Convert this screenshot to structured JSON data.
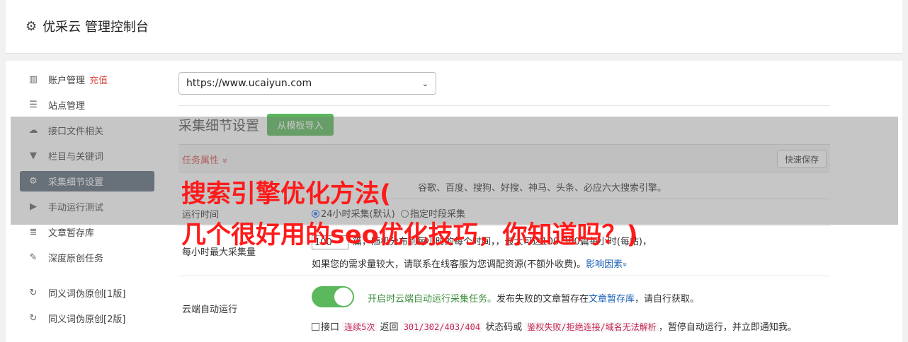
{
  "header": {
    "gear_icon": "gear-icon",
    "title": "优采云 管理控制台"
  },
  "sidebar": {
    "items": [
      {
        "icon": "bar-chart-icon",
        "label": "账户管理",
        "extra": "充值"
      },
      {
        "icon": "server-icon",
        "label": "站点管理"
      },
      {
        "icon": "cloud-upload-icon",
        "label": "接口文件相关"
      },
      {
        "icon": "filter-icon",
        "label": "栏目与关键词"
      },
      {
        "icon": "gears-icon",
        "label": "采集细节设置",
        "active": true
      },
      {
        "icon": "play-icon",
        "label": "手动运行测试"
      },
      {
        "icon": "database-icon",
        "label": "文章暂存库"
      },
      {
        "icon": "edit-icon",
        "label": "深度原创任务"
      },
      {
        "icon": "refresh-icon",
        "label": "同义词伪原创[1版]"
      },
      {
        "icon": "refresh-icon",
        "label": "同义词伪原创[2版]"
      }
    ]
  },
  "site_select": {
    "value": "https://www.ucaiyun.com"
  },
  "section": {
    "title": "采集细节设置",
    "import_button": "从模板导入"
  },
  "panel": {
    "task_attr": "任务属性",
    "task_attr_chevron": "»",
    "quick_save": "快速保存"
  },
  "engines_row": {
    "text": "谷歌、百度、搜狗、好搜、神马、头条、必应六大搜索引擎。"
  },
  "run_time": {
    "label": "运行时间",
    "opt1": "24小时采集(默认)",
    "opt2": "指定时段采集"
  },
  "max_collect": {
    "label": "每小时最大采集量",
    "value": "100",
    "line1_tail": "篇，随机分布到每小时的每个时间，，最大可达100-300篇每小时(每站)，",
    "line2": "如果您的需求量较大，请联系在线客服为您调配资源(不额外收费)。",
    "link": "影响因素",
    "link_chevron": "»"
  },
  "cloud_run": {
    "label": "云端自动运行",
    "toggle_on": true,
    "line1_green": "开启时云端自动运行采集任务。",
    "line1_mid": "发布失败的文章暂存在",
    "line1_link": "文章暂存库",
    "line1_tail": "，请自行获取。",
    "line2_a": "接口",
    "line2_code1": "连续5次",
    "line2_b": "返回",
    "line2_code2": "301/302/403/404",
    "line2_c": "状态码或",
    "line2_code3": "鉴权失败/拒绝连接/域名无法解析",
    "line2_d": "，暂停自动运行，并立即通知我。"
  },
  "overlay": {
    "headline1": "搜索引擎优化方法(",
    "headline2": "几个很好用的seo优化技巧，你知道吗？)"
  },
  "colors": {
    "accent_green": "#5cb85c",
    "headline_red": "#ff1a1a",
    "sidebar_active": "#5d6b7b"
  }
}
